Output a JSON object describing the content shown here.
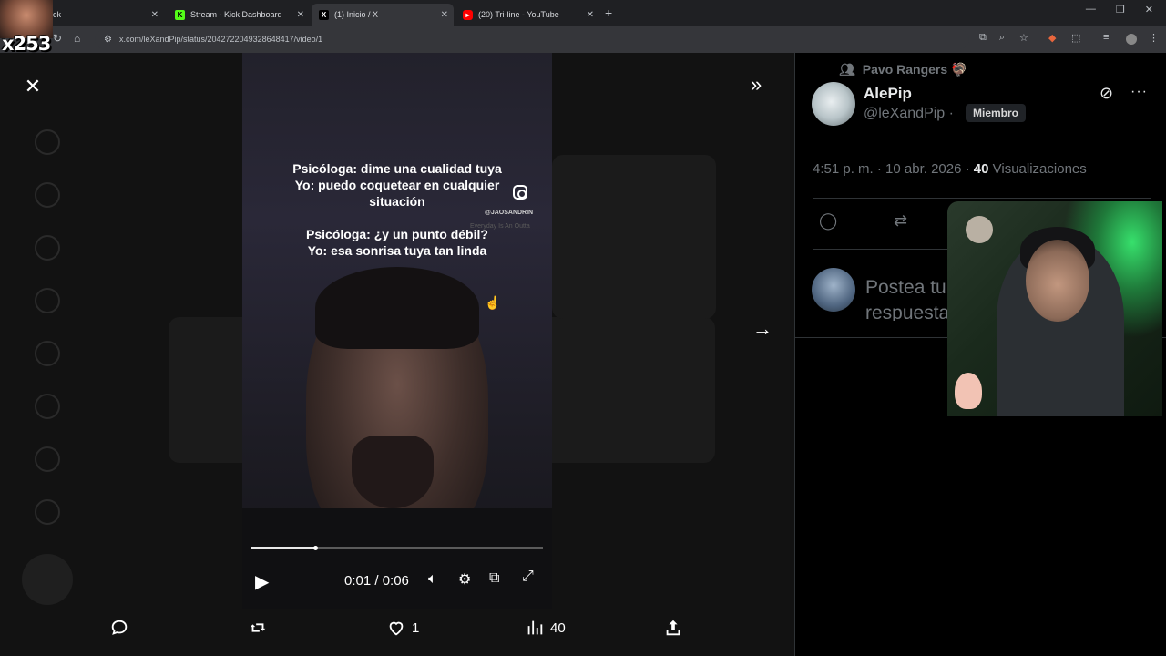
{
  "browser": {
    "tabs": [
      {
        "title": "ck",
        "favicon": "kick-icon",
        "active": false
      },
      {
        "title": "Stream - Kick Dashboard",
        "favicon": "kick-icon",
        "active": false
      },
      {
        "title": "(1) Inicio / X",
        "favicon": "x-icon",
        "active": true
      },
      {
        "title": "(20) Tri-line - YouTube",
        "favicon": "youtube-icon",
        "active": false
      }
    ],
    "url": "x.com/leXandPip/status/2042722049328648417/video/1"
  },
  "overlay": {
    "sub_count": "x253"
  },
  "video": {
    "caption_line1": "Psicóloga: dime una cualidad tuya",
    "caption_line2": "Yo: puedo coquetear en cualquier",
    "caption_line3": "situación",
    "caption_line4": "Psicóloga: ¿y un punto débil?",
    "caption_line5": "Yo: esa sonrisa tuya tan linda",
    "ig_handle": "@JAOSANDRIN",
    "ig_sub": "Everyday Is An Outta",
    "time": "0:01 / 0:06",
    "progress": 0.22
  },
  "actions": {
    "likes": "1",
    "views": "40"
  },
  "panel": {
    "community": "Pavo Rangers 🦃",
    "author_name": "AlePip",
    "author_handle": "@leXandPip ·",
    "badge": "Miembro",
    "meta_time": "4:51 p. m. · 10 abr. 2026 · ",
    "meta_views": "40",
    "meta_views_label": " Visualizaciones",
    "reply_placeholder": "Postea tu respuesta"
  },
  "colors": {
    "accent": "#1d9bf0",
    "muted": "#71767b",
    "text": "#e7e9ea"
  }
}
